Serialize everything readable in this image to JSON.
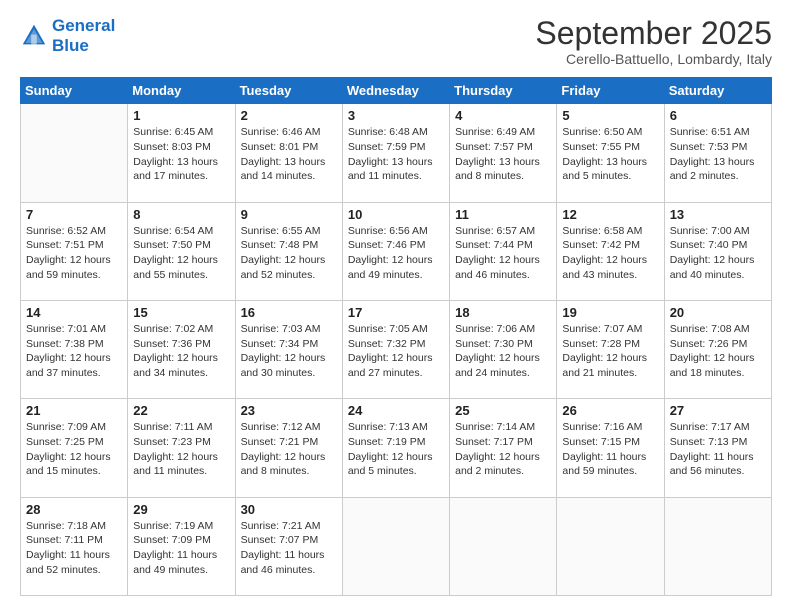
{
  "logo": {
    "line1": "General",
    "line2": "Blue"
  },
  "title": "September 2025",
  "subtitle": "Cerello-Battuello, Lombardy, Italy",
  "days": [
    "Sunday",
    "Monday",
    "Tuesday",
    "Wednesday",
    "Thursday",
    "Friday",
    "Saturday"
  ],
  "weeks": [
    [
      {
        "date": "",
        "sunrise": "",
        "sunset": "",
        "daylight": ""
      },
      {
        "date": "1",
        "sunrise": "Sunrise: 6:45 AM",
        "sunset": "Sunset: 8:03 PM",
        "daylight": "Daylight: 13 hours and 17 minutes."
      },
      {
        "date": "2",
        "sunrise": "Sunrise: 6:46 AM",
        "sunset": "Sunset: 8:01 PM",
        "daylight": "Daylight: 13 hours and 14 minutes."
      },
      {
        "date": "3",
        "sunrise": "Sunrise: 6:48 AM",
        "sunset": "Sunset: 7:59 PM",
        "daylight": "Daylight: 13 hours and 11 minutes."
      },
      {
        "date": "4",
        "sunrise": "Sunrise: 6:49 AM",
        "sunset": "Sunset: 7:57 PM",
        "daylight": "Daylight: 13 hours and 8 minutes."
      },
      {
        "date": "5",
        "sunrise": "Sunrise: 6:50 AM",
        "sunset": "Sunset: 7:55 PM",
        "daylight": "Daylight: 13 hours and 5 minutes."
      },
      {
        "date": "6",
        "sunrise": "Sunrise: 6:51 AM",
        "sunset": "Sunset: 7:53 PM",
        "daylight": "Daylight: 13 hours and 2 minutes."
      }
    ],
    [
      {
        "date": "7",
        "sunrise": "Sunrise: 6:52 AM",
        "sunset": "Sunset: 7:51 PM",
        "daylight": "Daylight: 12 hours and 59 minutes."
      },
      {
        "date": "8",
        "sunrise": "Sunrise: 6:54 AM",
        "sunset": "Sunset: 7:50 PM",
        "daylight": "Daylight: 12 hours and 55 minutes."
      },
      {
        "date": "9",
        "sunrise": "Sunrise: 6:55 AM",
        "sunset": "Sunset: 7:48 PM",
        "daylight": "Daylight: 12 hours and 52 minutes."
      },
      {
        "date": "10",
        "sunrise": "Sunrise: 6:56 AM",
        "sunset": "Sunset: 7:46 PM",
        "daylight": "Daylight: 12 hours and 49 minutes."
      },
      {
        "date": "11",
        "sunrise": "Sunrise: 6:57 AM",
        "sunset": "Sunset: 7:44 PM",
        "daylight": "Daylight: 12 hours and 46 minutes."
      },
      {
        "date": "12",
        "sunrise": "Sunrise: 6:58 AM",
        "sunset": "Sunset: 7:42 PM",
        "daylight": "Daylight: 12 hours and 43 minutes."
      },
      {
        "date": "13",
        "sunrise": "Sunrise: 7:00 AM",
        "sunset": "Sunset: 7:40 PM",
        "daylight": "Daylight: 12 hours and 40 minutes."
      }
    ],
    [
      {
        "date": "14",
        "sunrise": "Sunrise: 7:01 AM",
        "sunset": "Sunset: 7:38 PM",
        "daylight": "Daylight: 12 hours and 37 minutes."
      },
      {
        "date": "15",
        "sunrise": "Sunrise: 7:02 AM",
        "sunset": "Sunset: 7:36 PM",
        "daylight": "Daylight: 12 hours and 34 minutes."
      },
      {
        "date": "16",
        "sunrise": "Sunrise: 7:03 AM",
        "sunset": "Sunset: 7:34 PM",
        "daylight": "Daylight: 12 hours and 30 minutes."
      },
      {
        "date": "17",
        "sunrise": "Sunrise: 7:05 AM",
        "sunset": "Sunset: 7:32 PM",
        "daylight": "Daylight: 12 hours and 27 minutes."
      },
      {
        "date": "18",
        "sunrise": "Sunrise: 7:06 AM",
        "sunset": "Sunset: 7:30 PM",
        "daylight": "Daylight: 12 hours and 24 minutes."
      },
      {
        "date": "19",
        "sunrise": "Sunrise: 7:07 AM",
        "sunset": "Sunset: 7:28 PM",
        "daylight": "Daylight: 12 hours and 21 minutes."
      },
      {
        "date": "20",
        "sunrise": "Sunrise: 7:08 AM",
        "sunset": "Sunset: 7:26 PM",
        "daylight": "Daylight: 12 hours and 18 minutes."
      }
    ],
    [
      {
        "date": "21",
        "sunrise": "Sunrise: 7:09 AM",
        "sunset": "Sunset: 7:25 PM",
        "daylight": "Daylight: 12 hours and 15 minutes."
      },
      {
        "date": "22",
        "sunrise": "Sunrise: 7:11 AM",
        "sunset": "Sunset: 7:23 PM",
        "daylight": "Daylight: 12 hours and 11 minutes."
      },
      {
        "date": "23",
        "sunrise": "Sunrise: 7:12 AM",
        "sunset": "Sunset: 7:21 PM",
        "daylight": "Daylight: 12 hours and 8 minutes."
      },
      {
        "date": "24",
        "sunrise": "Sunrise: 7:13 AM",
        "sunset": "Sunset: 7:19 PM",
        "daylight": "Daylight: 12 hours and 5 minutes."
      },
      {
        "date": "25",
        "sunrise": "Sunrise: 7:14 AM",
        "sunset": "Sunset: 7:17 PM",
        "daylight": "Daylight: 12 hours and 2 minutes."
      },
      {
        "date": "26",
        "sunrise": "Sunrise: 7:16 AM",
        "sunset": "Sunset: 7:15 PM",
        "daylight": "Daylight: 11 hours and 59 minutes."
      },
      {
        "date": "27",
        "sunrise": "Sunrise: 7:17 AM",
        "sunset": "Sunset: 7:13 PM",
        "daylight": "Daylight: 11 hours and 56 minutes."
      }
    ],
    [
      {
        "date": "28",
        "sunrise": "Sunrise: 7:18 AM",
        "sunset": "Sunset: 7:11 PM",
        "daylight": "Daylight: 11 hours and 52 minutes."
      },
      {
        "date": "29",
        "sunrise": "Sunrise: 7:19 AM",
        "sunset": "Sunset: 7:09 PM",
        "daylight": "Daylight: 11 hours and 49 minutes."
      },
      {
        "date": "30",
        "sunrise": "Sunrise: 7:21 AM",
        "sunset": "Sunset: 7:07 PM",
        "daylight": "Daylight: 11 hours and 46 minutes."
      },
      {
        "date": "",
        "sunrise": "",
        "sunset": "",
        "daylight": ""
      },
      {
        "date": "",
        "sunrise": "",
        "sunset": "",
        "daylight": ""
      },
      {
        "date": "",
        "sunrise": "",
        "sunset": "",
        "daylight": ""
      },
      {
        "date": "",
        "sunrise": "",
        "sunset": "",
        "daylight": ""
      }
    ]
  ]
}
